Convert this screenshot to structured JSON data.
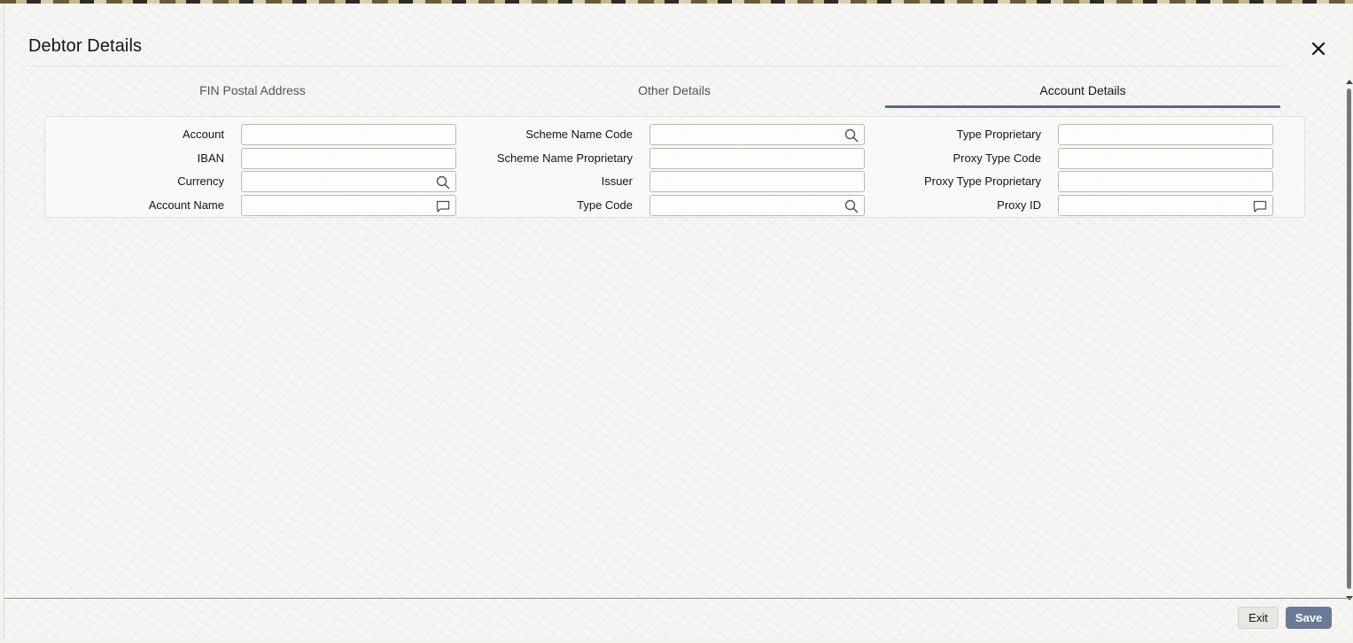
{
  "dialog": {
    "title": "Debtor Details",
    "close_icon": "close-icon"
  },
  "tabs": [
    {
      "label": "FIN Postal Address",
      "active": false
    },
    {
      "label": "Other Details",
      "active": false
    },
    {
      "label": "Account Details",
      "active": true
    }
  ],
  "form": {
    "column1": [
      {
        "label": "Account",
        "value": "",
        "icon": ""
      },
      {
        "label": "IBAN",
        "value": "",
        "icon": ""
      },
      {
        "label": "Currency",
        "value": "",
        "icon": "search-icon"
      },
      {
        "label": "Account Name",
        "value": "",
        "icon": "comment-icon"
      }
    ],
    "column2": [
      {
        "label": "Scheme Name Code",
        "value": "",
        "icon": "search-icon"
      },
      {
        "label": "Scheme Name Proprietary",
        "value": "",
        "icon": ""
      },
      {
        "label": "Issuer",
        "value": "",
        "icon": ""
      },
      {
        "label": "Type Code",
        "value": "",
        "icon": "search-icon"
      }
    ],
    "column3": [
      {
        "label": "Type Proprietary",
        "value": "",
        "icon": ""
      },
      {
        "label": "Proxy Type Code",
        "value": "",
        "icon": ""
      },
      {
        "label": "Proxy Type Proprietary",
        "value": "",
        "icon": ""
      },
      {
        "label": "Proxy ID",
        "value": "",
        "icon": "comment-icon"
      }
    ]
  },
  "footer": {
    "exit_label": "Exit",
    "save_label": "Save"
  },
  "colors": {
    "active_tab_underline": "#5a6b8a",
    "save_button": "#6a7a96"
  }
}
